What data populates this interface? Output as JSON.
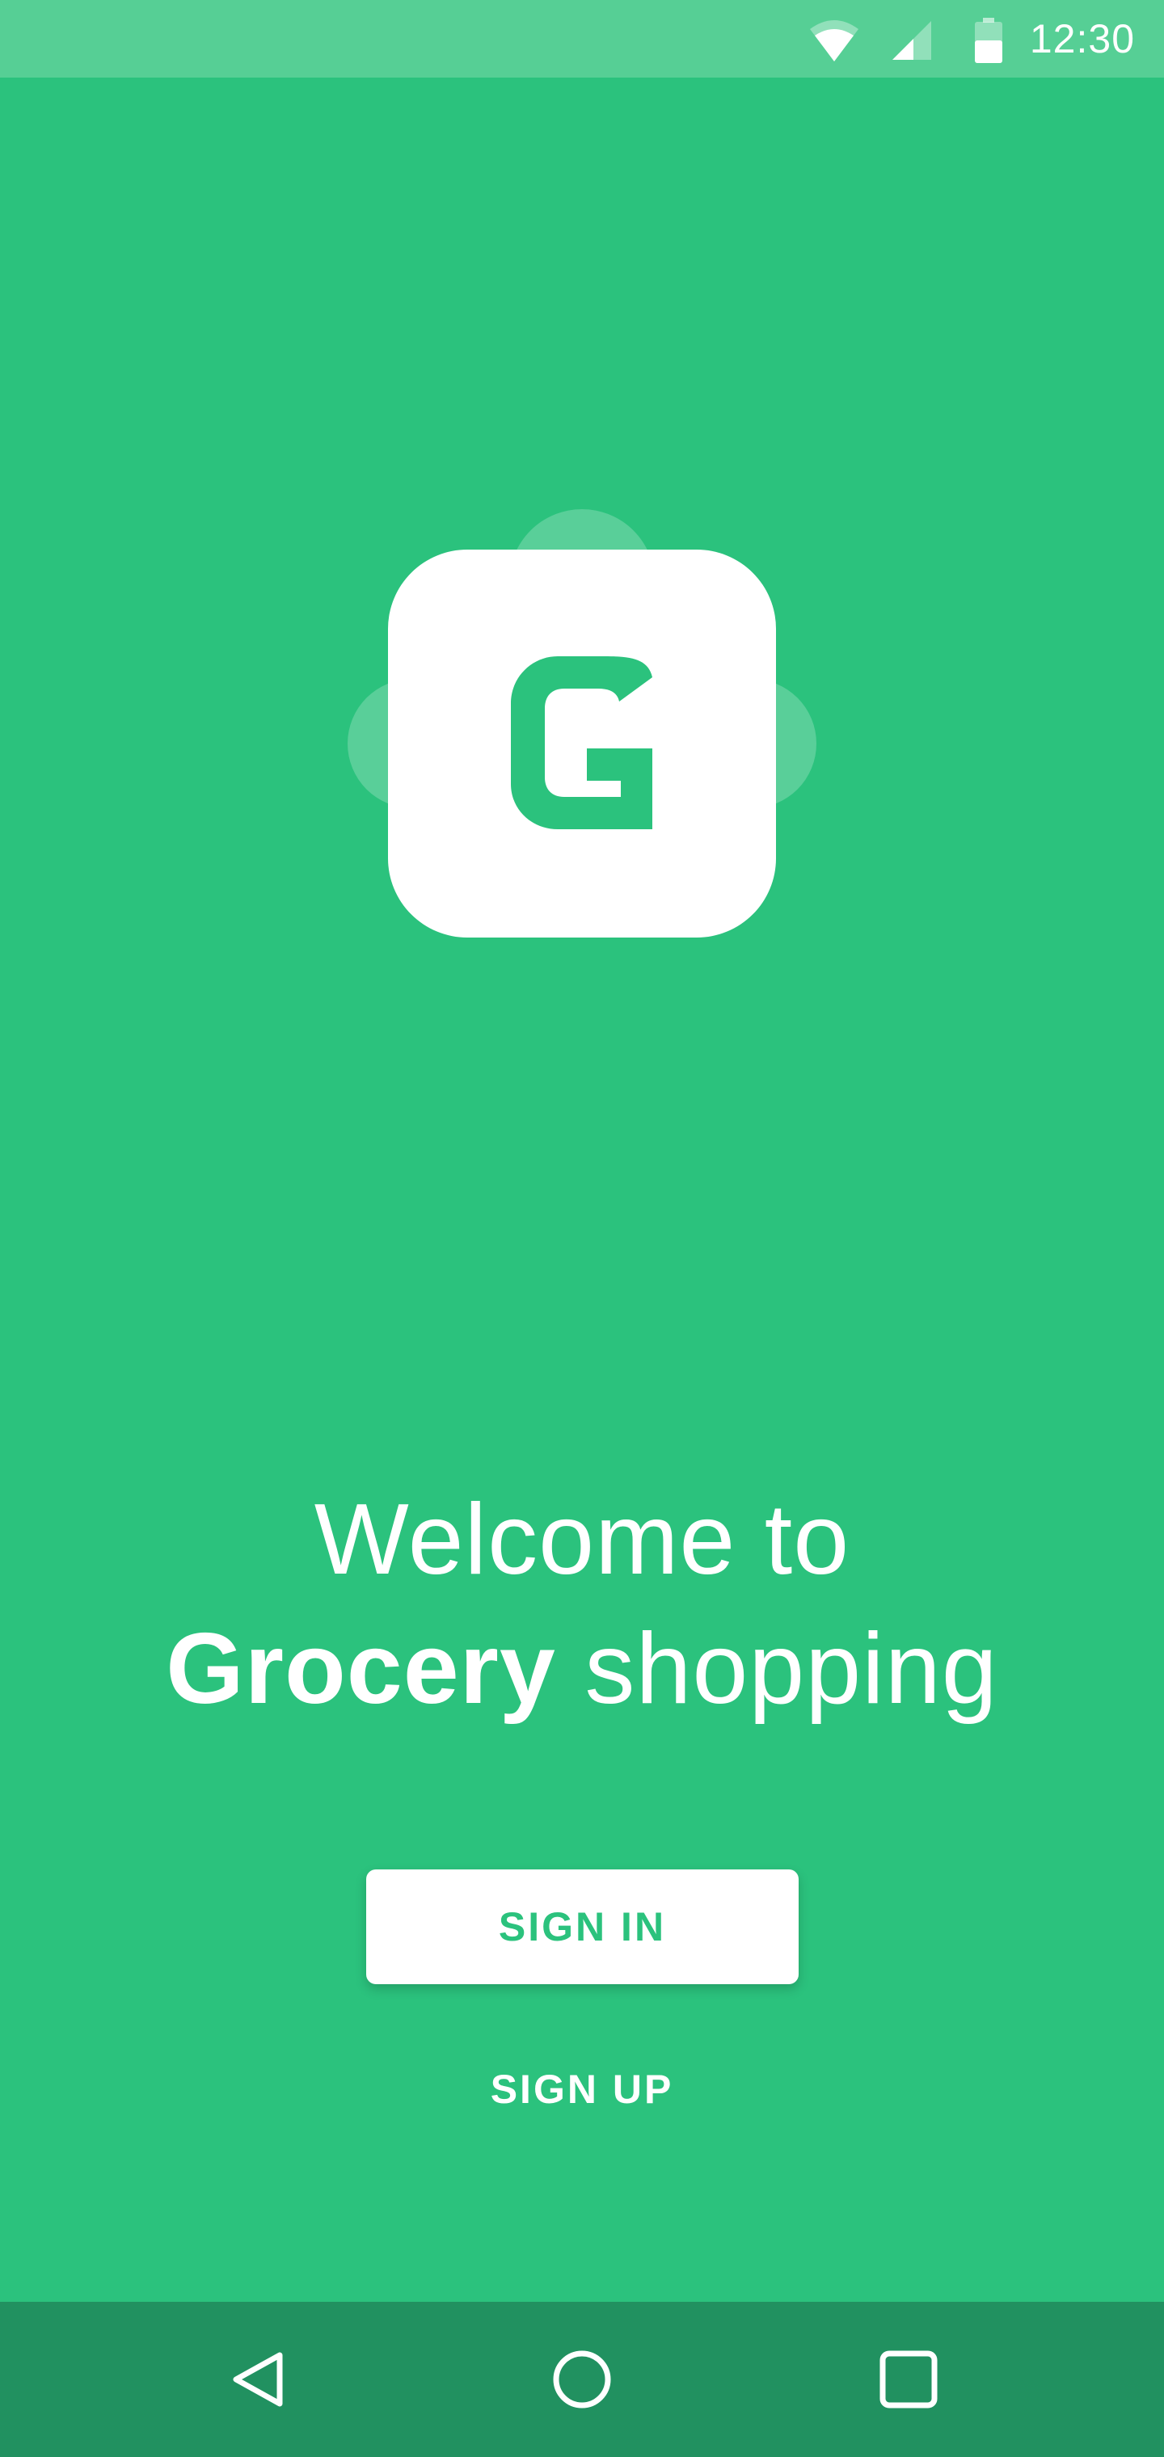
{
  "status_bar": {
    "time": "12:30",
    "icons": [
      "wifi-icon",
      "cell-signal-icon",
      "battery-icon"
    ]
  },
  "logo": {
    "letter": "G",
    "icon": "grocery-app-logo-icon"
  },
  "welcome": {
    "line1": "Welcome to",
    "line2_bold": "Grocery",
    "line2_light": " shopping"
  },
  "buttons": {
    "sign_in": "SIGN IN",
    "sign_up": "SIGN UP"
  },
  "nav_bar": {
    "icons": [
      "back-icon",
      "home-icon",
      "recents-icon"
    ]
  },
  "colors": {
    "background": "#2bc27d",
    "status_bar": "#56cf95",
    "nav_bar": "#219160",
    "button_bg": "#ffffff",
    "accent": "#2bc27d"
  }
}
